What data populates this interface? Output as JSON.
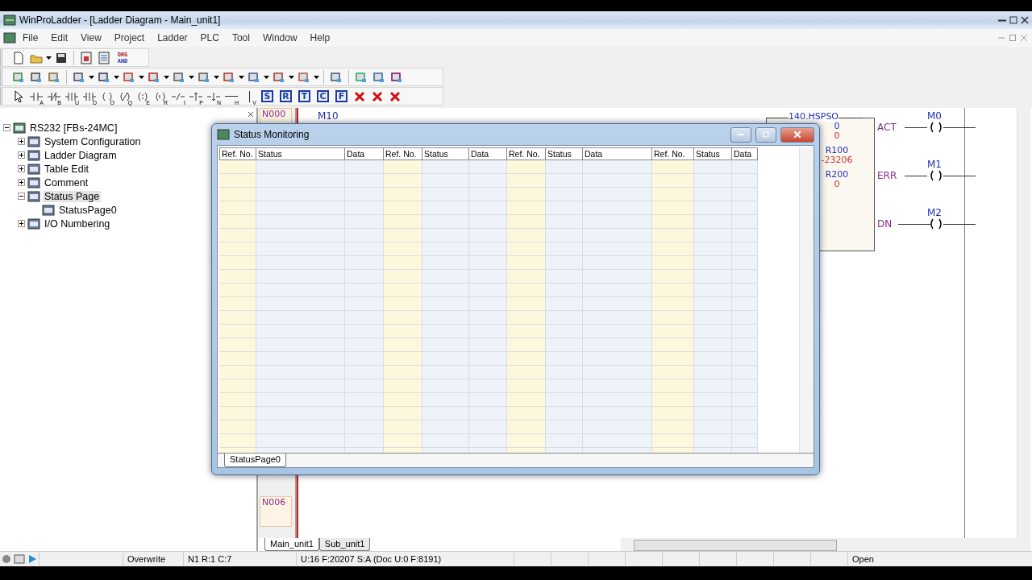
{
  "window": {
    "title": "WinProLadder - [Ladder Diagram - Main_unit1]"
  },
  "menu": [
    "File",
    "Edit",
    "View",
    "Project",
    "Ladder",
    "PLC",
    "Tool",
    "Window",
    "Help"
  ],
  "org_and_button": {
    "line_1": "ORG",
    "line_2": "AND"
  },
  "instruction_toolbar": {
    "contact_letters": [
      "A",
      "B",
      "U",
      "D",
      "O",
      "Q",
      "E",
      "R",
      "I",
      "P",
      "N",
      "H",
      "V"
    ],
    "letter_buttons": [
      "S",
      "R",
      "T",
      "C",
      "F"
    ]
  },
  "project_tree": [
    {
      "label": "RS232 [FBs-24MC]",
      "expanded": true,
      "selected": false,
      "children": [
        {
          "label": "System Configuration",
          "expanded": false,
          "selected": false
        },
        {
          "label": "Ladder Diagram",
          "expanded": false,
          "selected": false
        },
        {
          "label": "Table Edit",
          "expanded": false,
          "selected": false
        },
        {
          "label": "Comment",
          "expanded": false,
          "selected": false
        },
        {
          "label": "Status Page",
          "expanded": true,
          "selected": true,
          "children": [
            {
              "label": "StatusPage0",
              "selected": false
            }
          ]
        },
        {
          "label": "I/O Numbering",
          "expanded": false,
          "selected": false
        }
      ]
    }
  ],
  "ladder": {
    "rung_labels": [
      "N000",
      "N006"
    ],
    "top_coil": "M10",
    "function_block": {
      "title": "140.HSPSO",
      "values": [
        {
          "text": "0",
          "kind": "operand"
        },
        {
          "text": "0",
          "kind": "live"
        },
        {
          "text": "R100",
          "kind": "operand"
        },
        {
          "text": "-23206",
          "kind": "live"
        },
        {
          "text": "R200",
          "kind": "operand"
        },
        {
          "text": "0",
          "kind": "live"
        }
      ],
      "outputs": [
        {
          "pin": "ACT",
          "coil": "M0"
        },
        {
          "pin": "ERR",
          "coil": "M1"
        },
        {
          "pin": "DN",
          "coil": "M2"
        }
      ]
    },
    "tabs": [
      {
        "label": "Main_unit1",
        "selected": true
      },
      {
        "label": "Sub_unit1",
        "selected": false
      }
    ]
  },
  "status_monitoring": {
    "title": "Status Monitoring",
    "columns": [
      "Ref. No.",
      "Status",
      "Data",
      "Ref. No.",
      "Status",
      "Data",
      "Ref. No.",
      "Status",
      "Data",
      "Ref. No.",
      "Status",
      "Data"
    ],
    "tabs": [
      {
        "label": "StatusPage0",
        "selected": true
      }
    ]
  },
  "status_bar": {
    "mode": "Overwrite",
    "position": "N1 R:1 C:7",
    "memory": "U:16 F:20207 S:A (Doc U:0 F:8191)",
    "state": "Open"
  }
}
